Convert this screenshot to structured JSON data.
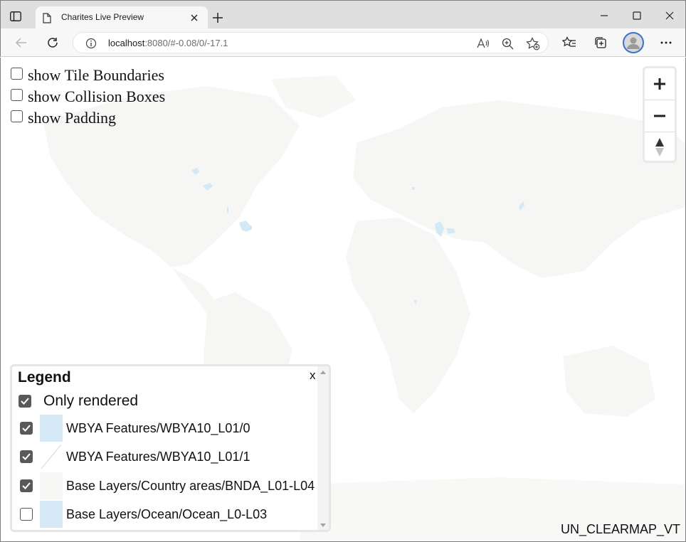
{
  "browser": {
    "tab_title": "Charites Live Preview",
    "url_host": "localhost",
    "url_rest": ":8080/#-0.08/0/-17.1"
  },
  "debug_options": [
    {
      "label": "show Tile Boundaries",
      "checked": false
    },
    {
      "label": "show Collision Boxes",
      "checked": false
    },
    {
      "label": "show Padding",
      "checked": false
    }
  ],
  "legend": {
    "title": "Legend",
    "close_label": "x",
    "only_rendered_label": "Only rendered",
    "only_rendered_checked": true,
    "items": [
      {
        "label": "WBYA Features/WBYA10_L01/0",
        "checked": true,
        "swatch": "fill",
        "color": "#d4e9f5"
      },
      {
        "label": "WBYA Features/WBYA10_L01/1",
        "checked": true,
        "swatch": "line",
        "color": "#dcdcdc"
      },
      {
        "label": "Base Layers/Country areas/BNDA_L01-L04",
        "checked": true,
        "swatch": "fill",
        "color": "#f7f7f6"
      },
      {
        "label": "Base Layers/Ocean/Ocean_L0-L03",
        "checked": false,
        "swatch": "fill",
        "color": "#d4e9f5"
      }
    ]
  },
  "attribution": "UN_CLEARMAP_VT",
  "colors": {
    "land": "#f6f6f4",
    "water": "#d4e9f5",
    "checkbox_checked": "#595959"
  }
}
